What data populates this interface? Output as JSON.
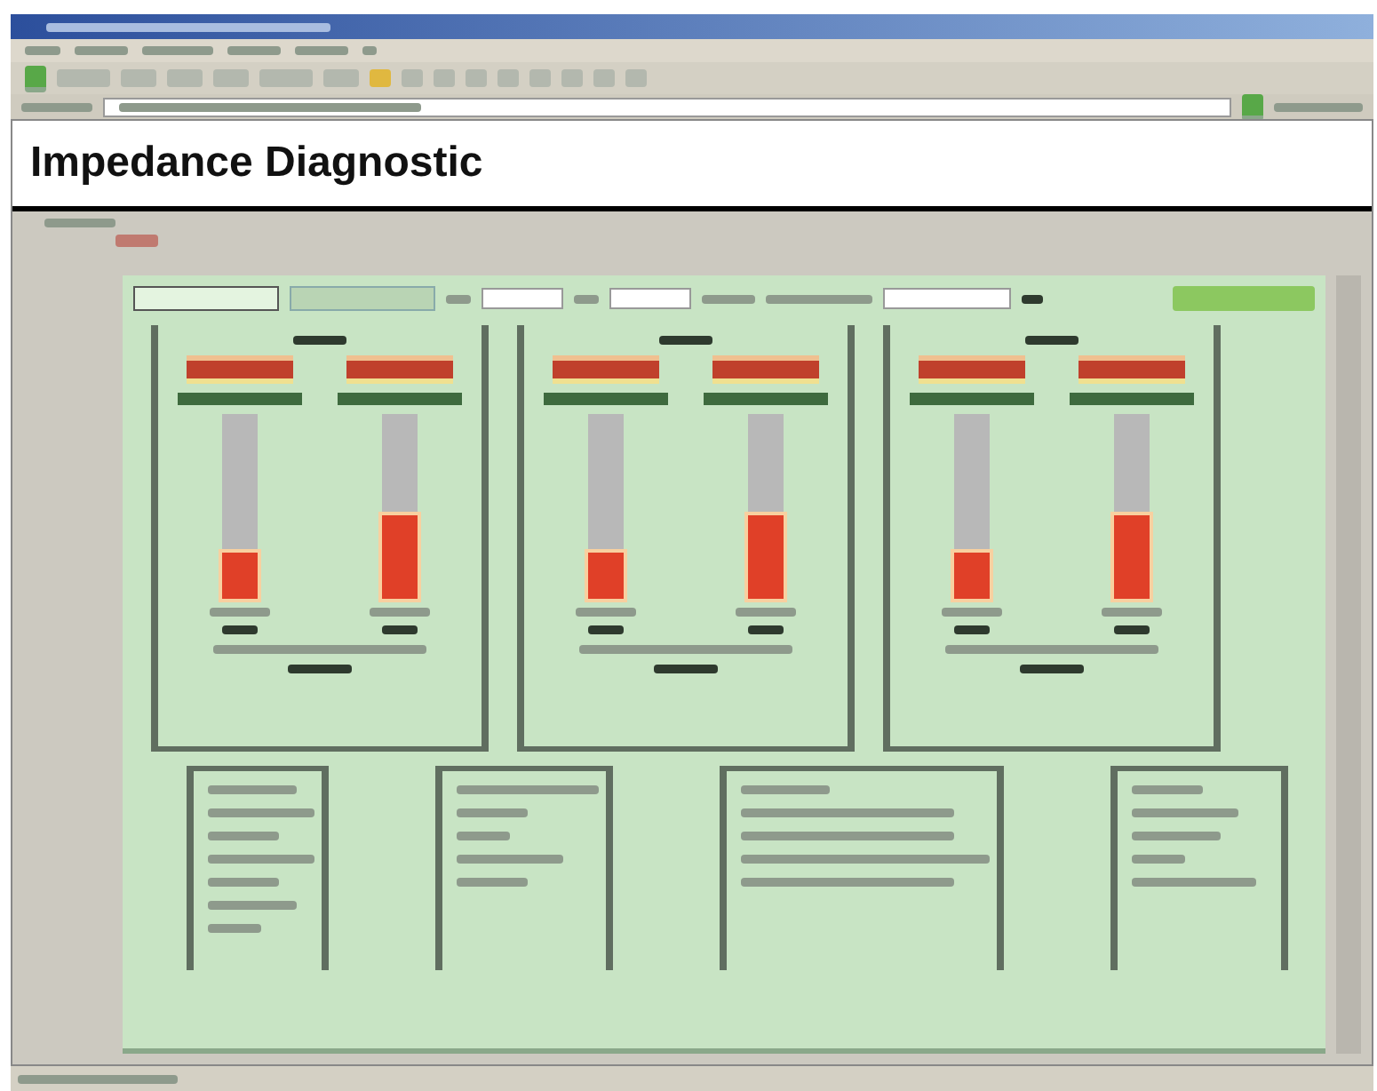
{
  "page": {
    "title": "Impedance Diagnostic"
  },
  "tabs": [
    {
      "selected": true
    },
    {
      "selected": false
    }
  ],
  "panels": [
    {
      "channels": [
        {
          "level": 0.25
        },
        {
          "level": 0.45
        }
      ]
    },
    {
      "channels": [
        {
          "level": 0.25
        },
        {
          "level": 0.45
        }
      ]
    },
    {
      "channels": [
        {
          "level": 0.25
        },
        {
          "level": 0.45
        }
      ]
    }
  ]
}
